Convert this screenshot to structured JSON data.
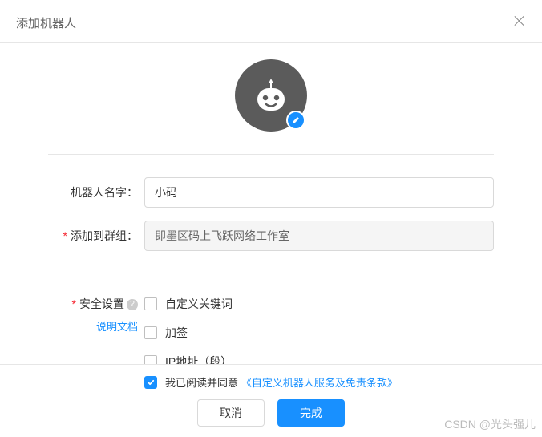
{
  "dialog": {
    "title": "添加机器人"
  },
  "form": {
    "name_label": "机器人名字：",
    "name_value": "小码",
    "group_label": "添加到群组：",
    "group_value": "即墨区码上飞跃网络工作室",
    "security_label": "安全设置",
    "doc_link": "说明文档",
    "opts": {
      "keyword": "自定义关键词",
      "sign": "加签",
      "ip": "IP地址（段）"
    }
  },
  "footer": {
    "agree_text": "我已阅读并同意",
    "terms_text": "《自定义机器人服务及免责条款》",
    "cancel": "取消",
    "submit": "完成"
  },
  "watermark": "CSDN @光头强儿"
}
